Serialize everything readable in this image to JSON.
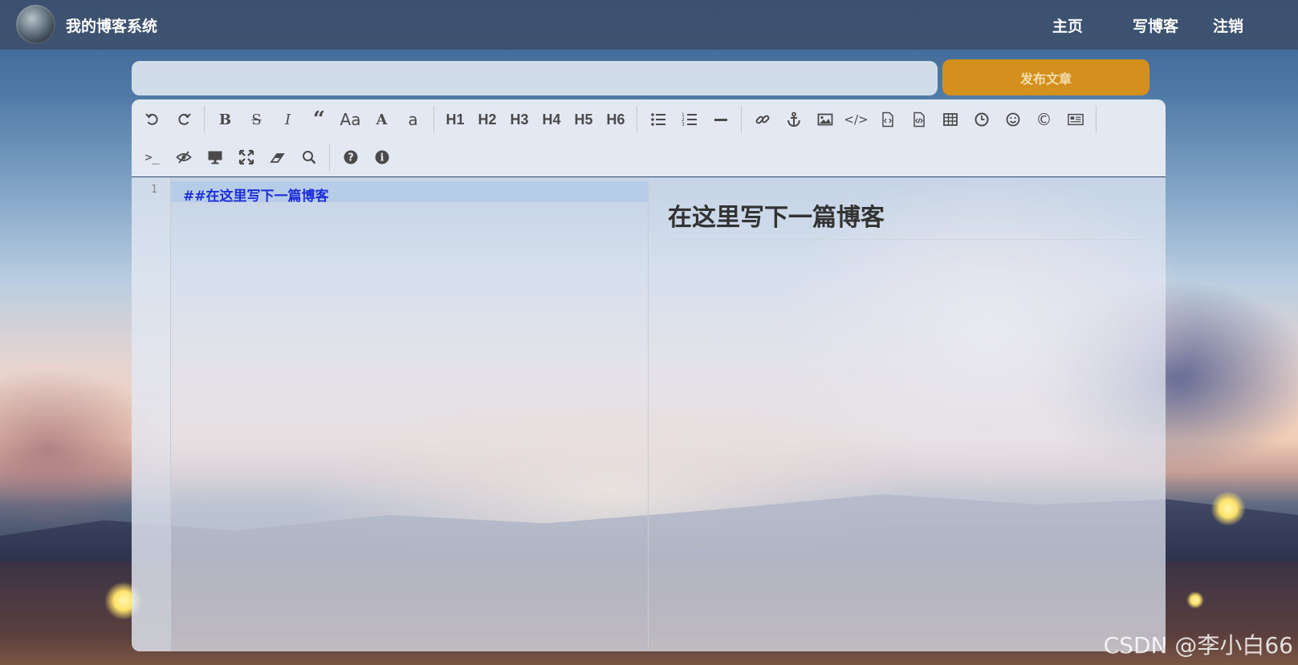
{
  "header": {
    "site_title": "我的博客系统",
    "nav": [
      "主页",
      "写博客",
      "注销"
    ]
  },
  "editor_header": {
    "title_placeholder": "",
    "publish_label": "发布文章"
  },
  "toolbar": {
    "headings": [
      "H1",
      "H2",
      "H3",
      "H4",
      "H5",
      "H6"
    ],
    "icons_row1": [
      "undo-icon",
      "redo-icon",
      "bold-icon",
      "strikethrough-icon",
      "italic-icon",
      "quote-icon",
      "uppercase-icon",
      "ucwords-icon",
      "lowercase-icon",
      "h1",
      "h2",
      "h3",
      "h4",
      "h5",
      "h6",
      "unordered-list-icon",
      "ordered-list-icon",
      "horizontal-rule-icon",
      "link-icon",
      "anchor-icon",
      "image-icon",
      "code-icon",
      "code-block-icon",
      "code-block-alt-icon",
      "table-icon",
      "datetime-icon",
      "emoji-icon",
      "html-entities-icon",
      "pagebreak-icon"
    ],
    "icons_row2": [
      "terminal-icon",
      "watch-toggle-icon",
      "preview-icon",
      "fullscreen-icon",
      "clear-icon",
      "search-icon",
      "help-icon",
      "info-icon"
    ]
  },
  "code": {
    "line_number": "1",
    "line_text": "##在这里写下一篇博客"
  },
  "preview": {
    "heading": "在这里写下一篇博客"
  },
  "watermark": "CSDN @李小白66",
  "colors": {
    "accent": "#d4901c",
    "code_text": "#1d2fd8",
    "navbar": "#3c4e68"
  }
}
